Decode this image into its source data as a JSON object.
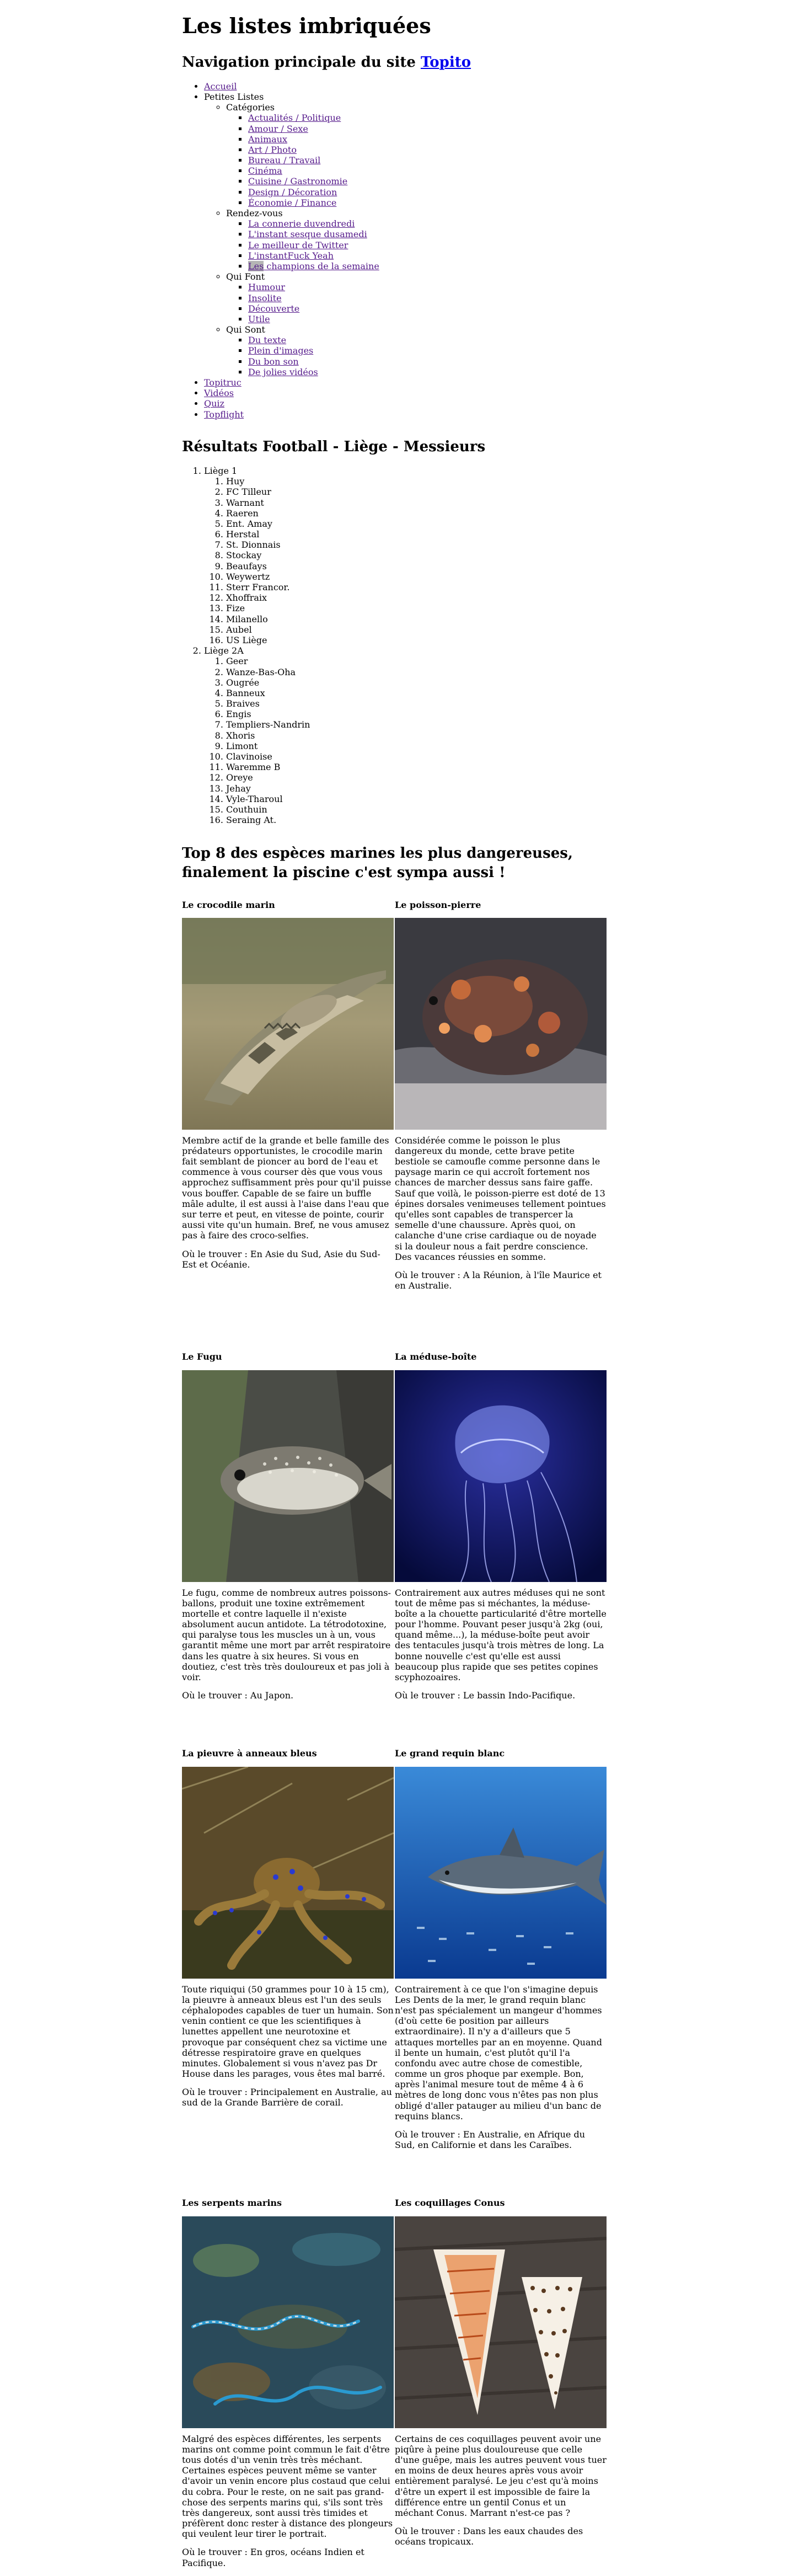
{
  "page_title": "Les listes imbriquées",
  "nav": {
    "heading_prefix": "Navigation principale du site ",
    "heading_link": "Topito",
    "items": [
      {
        "label": "Accueil"
      },
      {
        "label": "Petites Listes",
        "groups": [
          {
            "label": "Catégories",
            "links": [
              "Actualités / Politique",
              "Amour / Sexe",
              "Animaux",
              "Art / Photo",
              "Bureau / Travail",
              "Cinéma",
              "Cuisine / Gastronomie",
              "Design / Décoration",
              "Économie / Finance"
            ]
          },
          {
            "label": "Rendez-vous",
            "links": [
              "La connerie duvendredi",
              "L'instant sesque dusamedi",
              "Le meilleur de Twitter",
              "L'instantFuck Yeah",
              "Les champions de la semaine"
            ]
          },
          {
            "label": "Qui Font",
            "links": [
              "Humour",
              "Insolite",
              "Découverte",
              "Utile"
            ]
          },
          {
            "label": "Qui Sont",
            "links": [
              "Du texte",
              "Plein d'images",
              "Du bon son",
              "De jolies vidéos"
            ]
          }
        ]
      },
      {
        "label": "Topitruc"
      },
      {
        "label": "Vidéos"
      },
      {
        "label": "Quiz"
      },
      {
        "label": "Topflight"
      }
    ]
  },
  "results": {
    "heading": "Résultats Football - Liège - Messieurs",
    "divisions": [
      {
        "name": "Liège 1",
        "teams": [
          "Huy",
          "FC Tilleur",
          "Warnant",
          "Raeren",
          "Ent. Amay",
          "Herstal",
          "St. Dionnais",
          "Stockay",
          "Beaufays",
          "Weywertz",
          "Sterr Francor.",
          "Xhoffraix",
          "Fize",
          "Milanello",
          "Aubel",
          "US Liège"
        ]
      },
      {
        "name": "Liège 2A",
        "teams": [
          "Geer",
          "Wanze-Bas-Oha",
          "Ougrée",
          "Banneux",
          "Braives",
          "Engis",
          "Templiers-Nandrin",
          "Xhoris",
          "Limont",
          "Clavinoise",
          "Waremme B",
          "Oreye",
          "Jehay",
          "Vyle-Tharoul",
          "Couthuin",
          "Seraing At."
        ]
      }
    ]
  },
  "top8": {
    "heading": "Top 8 des espèces marines les plus dangereuses, finalement la piscine c'est sympa aussi !",
    "species": [
      {
        "name": "Le crocodile marin",
        "photo": "crocodile",
        "text": "Membre actif de la grande et belle famille des prédateurs opportunistes, le crocodile marin fait semblant de pioncer au bord de l'eau et commence à vous courser dès que vous vous approchez suffisamment près pour qu'il puisse vous bouffer. Capable de se faire un buffle mâle adulte, il est aussi à l'aise dans l'eau que sur terre et peut, en vitesse de pointe, courir aussi vite qu'un humain. Bref, ne vous amusez pas à faire des croco-selfies.",
        "where": "Où le trouver : En Asie du Sud, Asie du Sud-Est et Océanie."
      },
      {
        "name": "Le poisson-pierre",
        "photo": "stonefish",
        "text": "Considérée comme le poisson le plus dangereux du monde, cette brave petite bestiole se camoufle comme personne dans le paysage marin ce qui accroît fortement nos chances de marcher dessus sans faire gaffe. Sauf que voilà, le poisson-pierre est doté de 13 épines dorsales venimeuses tellement pointues qu'elles sont capables de transpercer la semelle d'une chaussure. Après quoi, on calanche d'une crise cardiaque ou de noyade si la douleur nous a fait perdre conscience. Des vacances réussies en somme.",
        "where": "Où le trouver : A la Réunion, à l'île Maurice et en Australie."
      },
      {
        "name": "Le Fugu",
        "photo": "fugu",
        "text": "Le fugu, comme de nombreux autres poissons-ballons, produit une toxine extrêmement mortelle et contre laquelle il n'existe absolument aucun antidote. La tétrodotoxine, qui paralyse tous les muscles un à un, vous garantit même une mort par arrêt respiratoire dans les quatre à six heures. Si vous en doutiez, c'est très très douloureux et pas joli à voir.",
        "where": "Où le trouver : Au Japon."
      },
      {
        "name": "La méduse-boîte",
        "photo": "jellyfish",
        "text": "Contrairement aux autres méduses qui ne sont tout de même pas si méchantes, la méduse-boîte a la chouette particularité d'être mortelle pour l'homme. Pouvant peser jusqu'à 2kg (oui, quand même...), la méduse-boîte peut avoir des tentacules jusqu'à trois mètres de long. La bonne nouvelle c'est qu'elle est aussi beaucoup plus rapide que ses petites copines scyphozoaires.",
        "where": "Où le trouver : Le bassin Indo-Pacifique."
      },
      {
        "name": "La pieuvre à anneaux bleus",
        "photo": "octopus",
        "text": "Toute riquiqui (50 grammes pour 10 à 15 cm), la pieuvre à anneaux bleus est l'un des seuls céphalopodes capables de tuer un humain. Son venin contient ce que les scientifiques à lunettes appellent une neurotoxine et provoque par conséquent chez sa victime une détresse respiratoire grave en quelques minutes. Globalement si vous n'avez pas Dr House dans les parages, vous êtes mal barré.",
        "where": "Où le trouver : Principalement en Australie, au sud de la Grande Barrière de corail."
      },
      {
        "name": "Le grand requin blanc",
        "photo": "shark",
        "text": "Contrairement à ce que l'on s'imagine depuis Les Dents de la mer, le grand requin blanc n'est pas spécialement un mangeur d'hommes (d'où cette 6e position par ailleurs extraordinaire). Il n'y a d'ailleurs que 5 attaques mortelles par an en moyenne. Quand il bente un humain, c'est plutôt qu'il l'a confondu avec autre chose de comestible, comme un gros phoque par exemple. Bon, après l'animal mesure tout de même 4 à 6 mètres de long donc vous n'êtes pas non plus obligé d'aller patauger au milieu d'un banc de requins blancs.",
        "where": "Où le trouver : En Australie, en Afrique du Sud, en Californie et dans les Caraïbes."
      },
      {
        "name": "Les serpents marins",
        "photo": "seasnakes",
        "text": "Malgré des espèces différentes, les serpents marins ont comme point commun le fait d'être tous dotés d'un venin très très méchant. Certaines espèces peuvent même se vanter d'avoir un venin encore plus costaud que celui du cobra. Pour le reste, on ne sait pas grand-chose des serpents marins qui, s'ils sont très très dangereux, sont aussi très timides et préfèrent donc rester à distance des plongeurs qui veulent leur tirer le portrait.",
        "where": "Où le trouver : En gros, océans Indien et Pacifique."
      },
      {
        "name": "Les coquillages Conus",
        "photo": "conus",
        "text": "Certains de ces coquillages peuvent avoir une piqûre à peine plus douloureuse que celle d'une guêpe, mais les autres peuvent vous tuer en moins de deux heures après vous avoir entièrement paralysé. Le jeu c'est qu'à moins d'être un expert il est impossible de faire la différence entre un gentil Conus et un méchant Conus. Marrant n'est-ce pas ?",
        "where": "Où le trouver : Dans les eaux chaudes des océans tropicaux."
      }
    ]
  }
}
